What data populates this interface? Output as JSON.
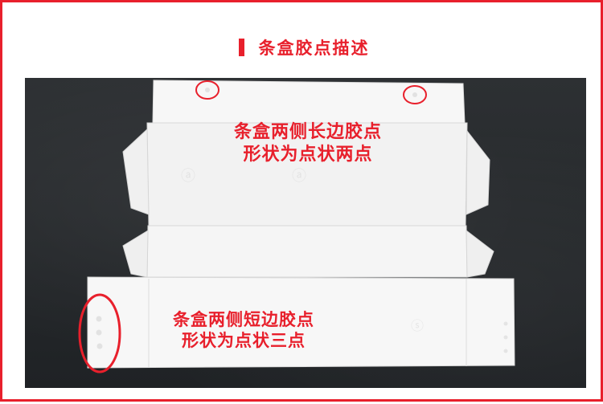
{
  "header": {
    "title": "条盒胶点描述"
  },
  "annotations": {
    "long_side": {
      "line1": "条盒两侧长边胶点",
      "line2": "形状为点状两点"
    },
    "short_side": {
      "line1": "条盒两侧短边胶点",
      "line2": "形状为点状三点"
    }
  },
  "colors": {
    "accent": "#e8202c",
    "background_photo": "#26292c",
    "paper": "#f6f6f6"
  }
}
